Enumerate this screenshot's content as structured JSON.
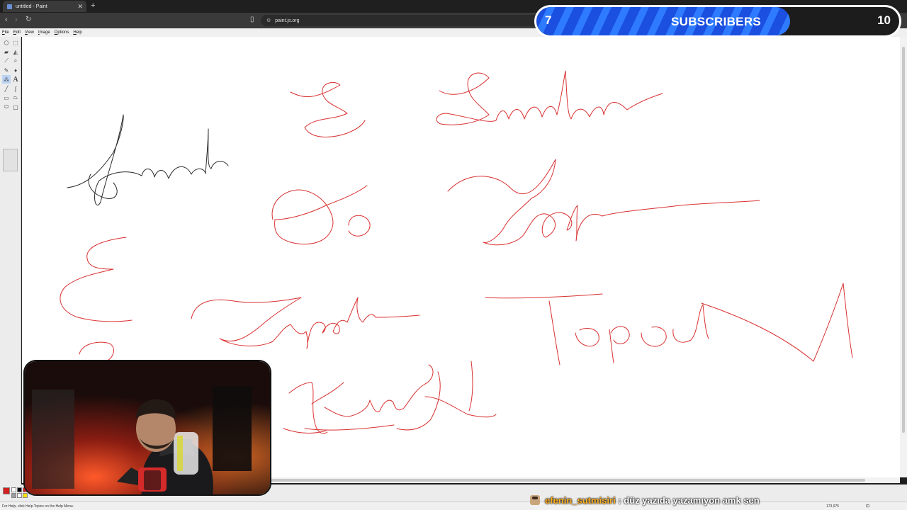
{
  "browser": {
    "tab_title": "untitled - Paint",
    "tab_close": "✕",
    "new_tab": "+",
    "url": "paint.js.org"
  },
  "menu": [
    {
      "key": "F",
      "rest": "ile"
    },
    {
      "key": "E",
      "rest": "dit"
    },
    {
      "key": "V",
      "rest": "iew"
    },
    {
      "key": "I",
      "rest": "mage"
    },
    {
      "key": "O",
      "rest": "ptions"
    },
    {
      "key": "H",
      "rest": "elp"
    }
  ],
  "tools": [
    "free-select",
    "select",
    "eraser",
    "fill",
    "color-picker",
    "magnifier",
    "pencil",
    "brush",
    "airbrush",
    "text",
    "line",
    "curve",
    "rectangle",
    "polygon",
    "ellipse",
    "rounded-rectangle"
  ],
  "status": {
    "help_text": "For Help, click Help Topics on the Help Menu.",
    "coords": "173,975"
  },
  "overlay": {
    "current": "7",
    "label": "SUBSCRIBERS",
    "goal": "10",
    "progress": 0.7
  },
  "chat": {
    "user": "efenin_sutmisiri",
    "separator": " : ",
    "message": "düz yazıda yazamıyon amk sen"
  },
  "colors": {
    "ink_black": "#111111",
    "ink_red": "#d21f1f",
    "overlay_blue": "#1a4fe0",
    "chat_user": "#ffb020"
  }
}
